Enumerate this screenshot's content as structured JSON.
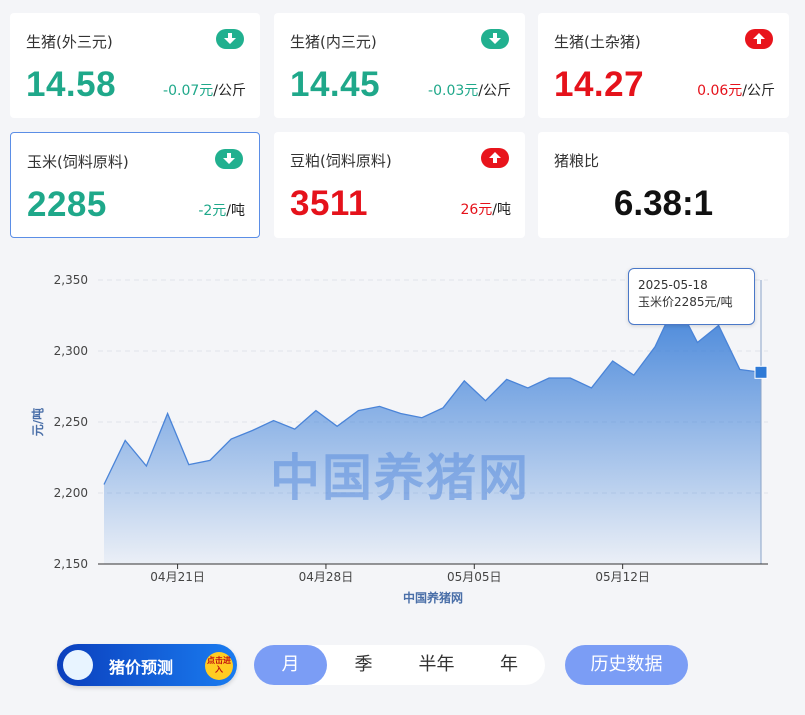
{
  "cards": [
    {
      "title": "生猪(外三元)",
      "price": "14.58",
      "change": "-0.07元",
      "unit": "/公斤",
      "direction": "down"
    },
    {
      "title": "生猪(内三元)",
      "price": "14.45",
      "change": "-0.03元",
      "unit": "/公斤",
      "direction": "down"
    },
    {
      "title": "生猪(土杂猪)",
      "price": "14.27",
      "change": "0.06元",
      "unit": "/公斤",
      "direction": "up"
    },
    {
      "title": "玉米(饲料原料)",
      "price": "2285",
      "change": "-2元",
      "unit": "/吨",
      "direction": "down"
    },
    {
      "title": "豆粕(饲料原料)",
      "price": "3511",
      "change": "26元",
      "unit": "/吨",
      "direction": "up"
    },
    {
      "title": "猪粮比",
      "price": "6.38:1"
    }
  ],
  "colors": {
    "down": "#1fa88a",
    "up": "#e5121b",
    "accent": "#7b9df5",
    "series": "#3b7fd8"
  },
  "tooltip": {
    "date": "2025-05-18",
    "text": "玉米价2285元/吨"
  },
  "watermark": "中国养猪网",
  "chart_data": {
    "type": "area",
    "ylabel": "元/吨",
    "xlabel": "中国养猪网",
    "ylim": [
      2150,
      2350
    ],
    "yticks": [
      "2,150",
      "2,200",
      "2,250",
      "2,300",
      "2,350"
    ],
    "ytick_values": [
      2150,
      2200,
      2250,
      2300,
      2350
    ],
    "xtick_labels": [
      "04月21日",
      "04月28日",
      "05月05日",
      "05月12日"
    ],
    "grid": true,
    "values": [
      2206,
      2237,
      2219,
      2256,
      2220,
      2223,
      2238,
      2244,
      2251,
      2245,
      2258,
      2247,
      2258,
      2261,
      2256,
      2253,
      2260,
      2279,
      2265,
      2280,
      2274,
      2281,
      2281,
      2274,
      2293,
      2283,
      2303,
      2335,
      2306,
      2318,
      2287,
      2285
    ]
  },
  "bottom": {
    "predict_label": "猪价预测",
    "predict_tap": "点击进入",
    "tabs": [
      "月",
      "季",
      "半年",
      "年"
    ],
    "active_tab": "月",
    "history": "历史数据"
  }
}
